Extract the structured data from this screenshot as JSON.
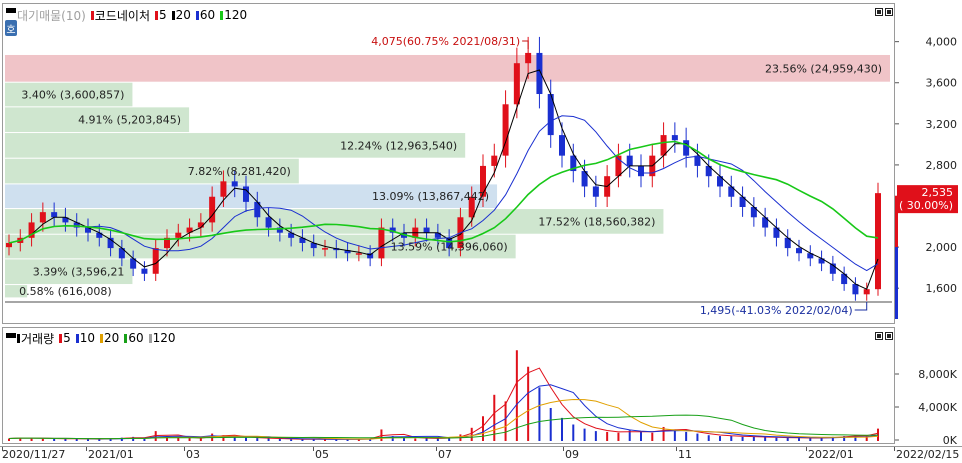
{
  "price_panel": {
    "legend": {
      "title": "대기매물(10)",
      "stock_name": "코드네이처",
      "ma": [
        {
          "period": "5",
          "color": "#e0101a"
        },
        {
          "period": "20",
          "color": "#000000"
        },
        {
          "period": "60",
          "color": "#1a2fd0"
        },
        {
          "period": "120",
          "color": "#18c818"
        }
      ]
    },
    "side_button": "호",
    "y_ticks": [
      "4,000",
      "3,600",
      "3,200",
      "2,800",
      "2,000",
      "1,600"
    ],
    "y_tick_values": [
      4000,
      3600,
      3200,
      2800,
      2000,
      1600
    ],
    "y_range": [
      1300,
      4240
    ],
    "current_price": {
      "value": "2,535",
      "change": "( 30.00%)",
      "price": 2535,
      "color": "#e0101a"
    },
    "high_annotation": {
      "text": "4,075(60.75% 2021/08/31)",
      "price": 4075,
      "color": "#c81010"
    },
    "low_annotation": {
      "text": "1,495(-41.03% 2022/02/04)",
      "price": 1495,
      "color": "#1a2fa0"
    },
    "volume_profile": [
      {
        "label": "23.56% (24,959,430)",
        "price_low": 3620,
        "price_high": 3880,
        "fraction": 1.0,
        "highlight": "max"
      },
      {
        "label": "3.40% (3,600,857)",
        "price_low": 3380,
        "price_high": 3610,
        "fraction": 0.144
      },
      {
        "label": "4.91% (5,203,845)",
        "price_low": 3130,
        "price_high": 3370,
        "fraction": 0.208
      },
      {
        "label": "12.24% (12,963,540)",
        "price_low": 2880,
        "price_high": 3120,
        "fraction": 0.52
      },
      {
        "label": "7.82% (8,281,420)",
        "price_low": 2630,
        "price_high": 2870,
        "fraction": 0.332
      },
      {
        "label": "13.09% (13,867,442)",
        "price_low": 2390,
        "price_high": 2620,
        "fraction": 0.556,
        "highlight": "current"
      },
      {
        "label": "17.52% (18,560,382)",
        "price_low": 2140,
        "price_high": 2380,
        "fraction": 0.744
      },
      {
        "label": "13.59% (14,396,060)",
        "price_low": 1900,
        "price_high": 2130,
        "fraction": 0.577
      },
      {
        "label": "3.39% (3,596,21",
        "price_low": 1650,
        "price_high": 1890,
        "fraction": 0.144
      },
      {
        "label": "0.58% (616,008)",
        "price_low": 1520,
        "price_high": 1640,
        "fraction": 0.025
      }
    ]
  },
  "volume_panel": {
    "legend": {
      "title": "거래량",
      "ma": [
        {
          "period": "5",
          "color": "#e0101a"
        },
        {
          "period": "10",
          "color": "#1a2fd0"
        },
        {
          "period": "20",
          "color": "#e0a000"
        },
        {
          "period": "60",
          "color": "#18a018"
        },
        {
          "period": "120",
          "color": "#a0a0a0"
        }
      ]
    },
    "y_ticks": [
      "8,000K",
      "4,000K",
      "0K"
    ],
    "y_tick_values": [
      8000,
      4000,
      0
    ]
  },
  "x_axis": {
    "labels": [
      "2020/11/27",
      "2021/01",
      "03",
      "05",
      "07",
      "09",
      "11",
      "2022/01",
      "2022/02/15"
    ]
  },
  "chart_data": {
    "type": "candlestick",
    "title": "",
    "x_range": [
      "2020/11/27",
      "2022/02/15"
    ],
    "y_range": [
      1300,
      4240
    ],
    "series": [
      {
        "name": "5",
        "kind": "moving_average"
      },
      {
        "name": "20",
        "kind": "moving_average"
      },
      {
        "name": "60",
        "kind": "moving_average"
      },
      {
        "name": "120",
        "kind": "moving_average"
      }
    ],
    "approx_close": [
      2050,
      2100,
      2250,
      2350,
      2300,
      2250,
      2200,
      2150,
      2100,
      2000,
      1900,
      1800,
      1750,
      2000,
      2100,
      2150,
      2200,
      2250,
      2500,
      2650,
      2600,
      2450,
      2300,
      2200,
      2150,
      2100,
      2050,
      2000,
      2000,
      1980,
      1950,
      1950,
      1900,
      2200,
      2150,
      2100,
      2200,
      2150,
      2100,
      2000,
      2300,
      2500,
      2800,
      2900,
      3400,
      3800,
      3900,
      3500,
      3100,
      2900,
      2750,
      2600,
      2500,
      2700,
      2900,
      2800,
      2700,
      2900,
      3100,
      3050,
      2900,
      2800,
      2700,
      2600,
      2500,
      2400,
      2300,
      2200,
      2100,
      2000,
      1950,
      1900,
      1850,
      1750,
      1650,
      1550,
      1600,
      2535
    ],
    "volume_approx_k": [
      300,
      400,
      350,
      300,
      250,
      300,
      250,
      200,
      250,
      300,
      400,
      500,
      300,
      1200,
      600,
      400,
      350,
      300,
      900,
      700,
      500,
      400,
      350,
      300,
      250,
      200,
      200,
      250,
      200,
      200,
      200,
      250,
      300,
      1400,
      600,
      400,
      300,
      350,
      300,
      400,
      800,
      1600,
      3000,
      5600,
      4800,
      11000,
      9000,
      6500,
      4000,
      2800,
      2000,
      1500,
      1200,
      1100,
      1000,
      1300,
      1100,
      1000,
      1700,
      1400,
      1100,
      900,
      700,
      600,
      600,
      500,
      500,
      450,
      400,
      400,
      350,
      350,
      400,
      500,
      600,
      700,
      600,
      1500
    ]
  }
}
